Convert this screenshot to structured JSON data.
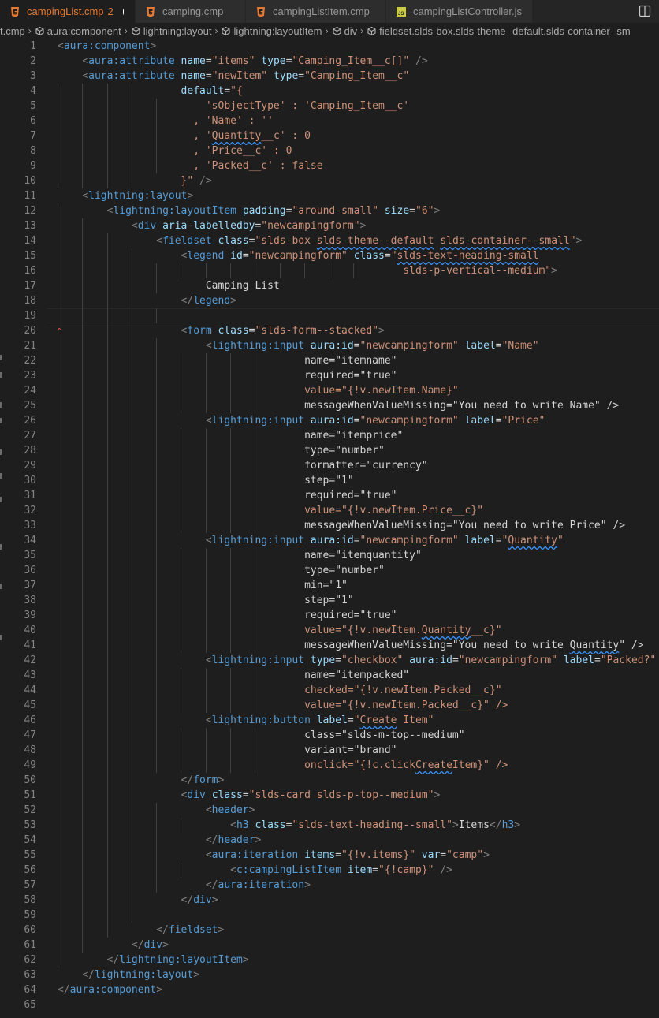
{
  "tabs": [
    {
      "label": "campingList.cmp",
      "badge": "2",
      "active": true,
      "modified": true,
      "icon": "html-file-icon"
    },
    {
      "label": "camping.cmp",
      "active": false,
      "icon": "html-file-icon"
    },
    {
      "label": "campingListItem.cmp",
      "active": false,
      "icon": "html-file-icon"
    },
    {
      "label": "campingListController.js",
      "active": false,
      "icon": "js-file-icon"
    }
  ],
  "breadcrumb": [
    {
      "label": "t.cmp",
      "icon": ""
    },
    {
      "label": "aura:component",
      "icon": "symbol-icon"
    },
    {
      "label": "lightning:layout",
      "icon": "symbol-icon"
    },
    {
      "label": "lightning:layoutItem",
      "icon": "symbol-icon"
    },
    {
      "label": "div",
      "icon": "symbol-icon"
    },
    {
      "label": "fieldset.slds-box.slds-theme--default.slds-container--sm",
      "icon": "symbol-icon"
    }
  ],
  "colors": {
    "tag": "#569cd6",
    "attribute": "#9cdcfe",
    "string": "#ce9178",
    "bracket": "#808080",
    "active_tab": "#e37933"
  },
  "lines": [
    "<aura:component>",
    "    <aura:attribute name=\"items\" type=\"Camping_Item__c[]\" />",
    "    <aura:attribute name=\"newItem\" type=\"Camping_Item__c\"",
    "                    default=\"{",
    "                        'sObjectType' : 'Camping_Item__c'",
    "                      , 'Name' : ''",
    "                      , 'Quantity__c' : 0",
    "                      , 'Price__c' : 0",
    "                      , 'Packed__c' : false",
    "                    }\" />",
    "    <lightning:layout>",
    "        <lightning:layoutItem padding=\"around-small\" size=\"6\">",
    "            <div aria-labelledby=\"newcampingform\">",
    "                <fieldset class=\"slds-box slds-theme--default slds-container--small\">",
    "                    <legend id=\"newcampingform\" class=\"slds-text-heading-small",
    "                                                        slds-p-vertical--medium\">",
    "                        Camping List",
    "                    </legend>",
    "",
    "                    <form class=\"slds-form--stacked\">",
    "                        <lightning:input aura:id=\"newcampingform\" label=\"Name\"",
    "                                        name=\"itemname\"",
    "                                        required=\"true\"",
    "                                        value=\"{!v.newItem.Name}\"",
    "                                        messageWhenValueMissing=\"You need to write Name\" />",
    "                        <lightning:input aura:id=\"newcampingform\" label=\"Price\"",
    "                                        name=\"itemprice\"",
    "                                        type=\"number\"",
    "                                        formatter=\"currency\"",
    "                                        step=\"1\"",
    "                                        required=\"true\"",
    "                                        value=\"{!v.newItem.Price__c}\"",
    "                                        messageWhenValueMissing=\"You need to write Price\" />",
    "                        <lightning:input aura:id=\"newcampingform\" label=\"Quantity\"",
    "                                        name=\"itemquantity\"",
    "                                        type=\"number\"",
    "                                        min=\"1\"",
    "                                        step=\"1\"",
    "                                        required=\"true\"",
    "                                        value=\"{!v.newItem.Quantity__c}\"",
    "                                        messageWhenValueMissing=\"You need to write Quantity\" />",
    "                        <lightning:input type=\"checkbox\" aura:id=\"newcampingform\" label=\"Packed?\"",
    "                                        name=\"itempacked\"",
    "                                        checked=\"{!v.newItem.Packed__c}\"",
    "                                        value=\"{!v.newItem.Packed__c}\" />",
    "                        <lightning:button label=\"Create Item\"",
    "                                        class=\"slds-m-top--medium\"",
    "                                        variant=\"brand\"",
    "                                        onclick=\"{!c.clickCreateItem}\" />",
    "                    </form>",
    "                    <div class=\"slds-card slds-p-top--medium\">",
    "                        <header>",
    "                            <h3 class=\"slds-text-heading--small\">Items</h3>",
    "                        </header>",
    "                        <aura:iteration items=\"{!v.items}\" var=\"camp\">",
    "                            <c:campingListItem item=\"{!camp}\" />",
    "                        </aura:iteration>",
    "                    </div>",
    "",
    "                </fieldset>",
    "            </div>",
    "        </lightning:layoutItem>",
    "    </lightning:layout>",
    "</aura:component>",
    ""
  ]
}
